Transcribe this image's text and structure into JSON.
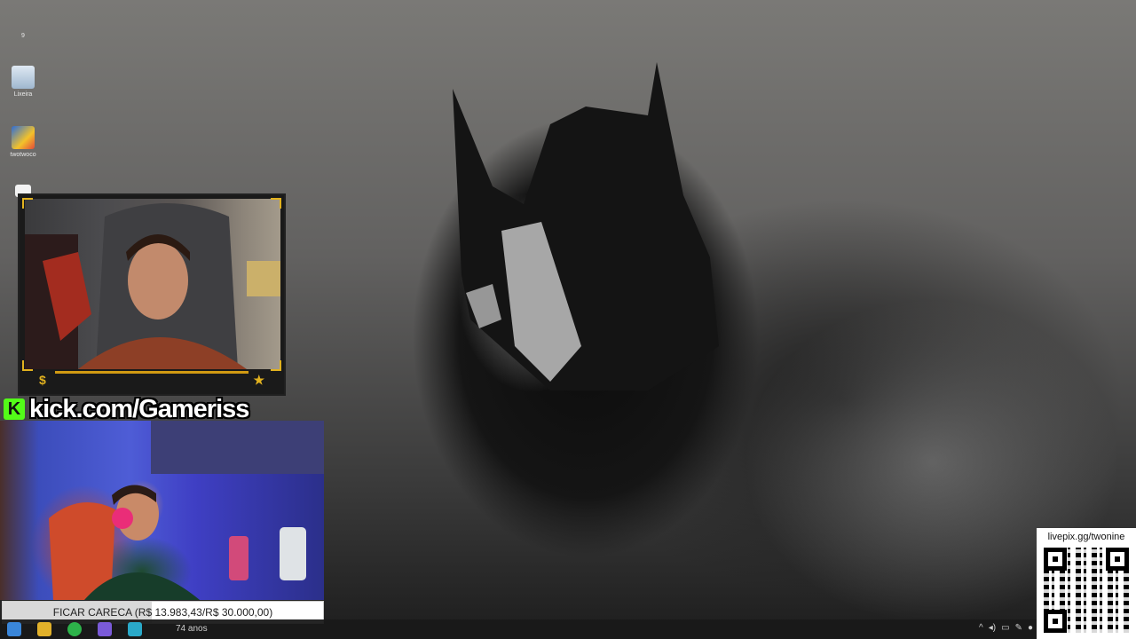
{
  "desktop": {
    "icons": [
      {
        "label": "9",
        "icon": "folder-icon"
      },
      {
        "label": "Lixeira",
        "icon": "recycle-bin-icon"
      },
      {
        "label": "twotwoco",
        "icon": "app-shortcut-icon"
      },
      {
        "label": "",
        "icon": "document-icon"
      }
    ]
  },
  "overlay": {
    "kick_url": "kick.com/Gameriss",
    "kick_logo": "K",
    "cam1_left_symbol": "$",
    "cam1_right_symbol": "★",
    "goal_text": "FICAR CARECA (R$ 13.983,43/R$ 30.000,00)",
    "goal_fraction": 0.466,
    "livepix_url": "livepix.gg/twonine"
  },
  "taskbar": {
    "partial_text": "74 anos",
    "accent": "#202020"
  },
  "colors": {
    "gold": "#e2b21f",
    "kick_green": "#53fc18"
  }
}
